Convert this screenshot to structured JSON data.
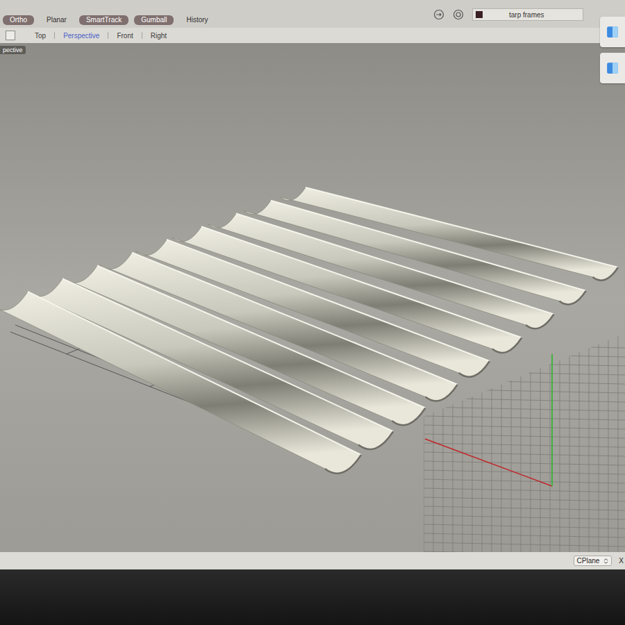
{
  "toolbar": {
    "toggles": [
      {
        "label": "Ortho",
        "on": true
      },
      {
        "label": "Planar",
        "on": false
      },
      {
        "label": "SmartTrack",
        "on": true
      },
      {
        "label": "Gumball",
        "on": true
      },
      {
        "label": "History",
        "on": false
      }
    ]
  },
  "layer": {
    "name": "tarp frames",
    "color": "#3a1f24"
  },
  "viewport_tabs": [
    {
      "label": "Top",
      "selected": false
    },
    {
      "label": "Perspective",
      "selected": true
    },
    {
      "label": "Front",
      "selected": false
    },
    {
      "label": "Right",
      "selected": false
    }
  ],
  "viewport": {
    "label": "pective"
  },
  "status_bar": {
    "cplane": "CPlane",
    "trailing": "X"
  }
}
